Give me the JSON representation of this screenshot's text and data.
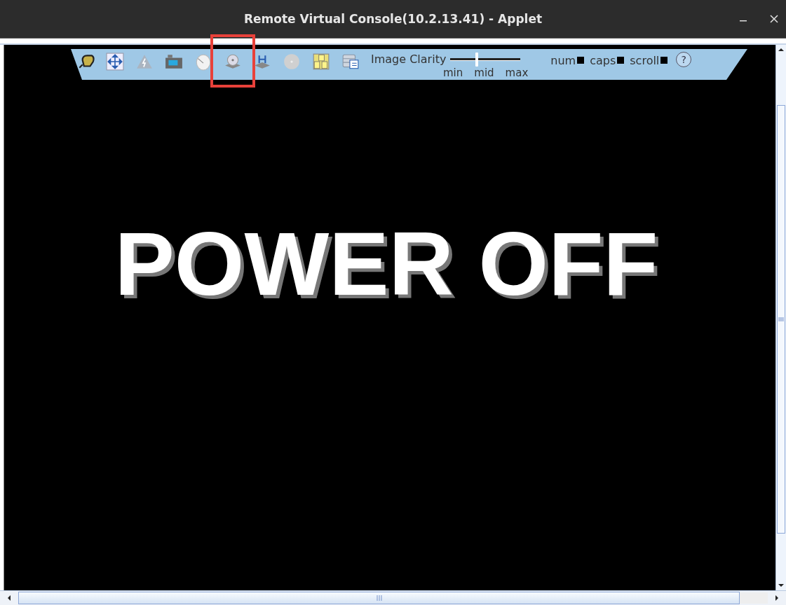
{
  "window": {
    "title": "Remote Virtual Console(10.2.13.41) - Applet"
  },
  "toolbar": {
    "buttons": [
      {
        "highlighted": false
      },
      {
        "highlighted": false
      },
      {
        "highlighted": false
      },
      {
        "highlighted": false
      },
      {
        "highlighted": false
      },
      {
        "highlighted": true
      },
      {
        "highlighted": false
      },
      {
        "highlighted": false
      },
      {
        "highlighted": false
      },
      {
        "highlighted": false
      }
    ],
    "clarity": {
      "label": "Image Clarity",
      "level": 0.38,
      "ticks": [
        "min",
        "mid",
        "max"
      ]
    },
    "indicators": [
      {
        "label": "num"
      },
      {
        "label": "caps"
      },
      {
        "label": "scroll"
      }
    ],
    "help": "?"
  },
  "console": {
    "message": "POWER OFF"
  }
}
